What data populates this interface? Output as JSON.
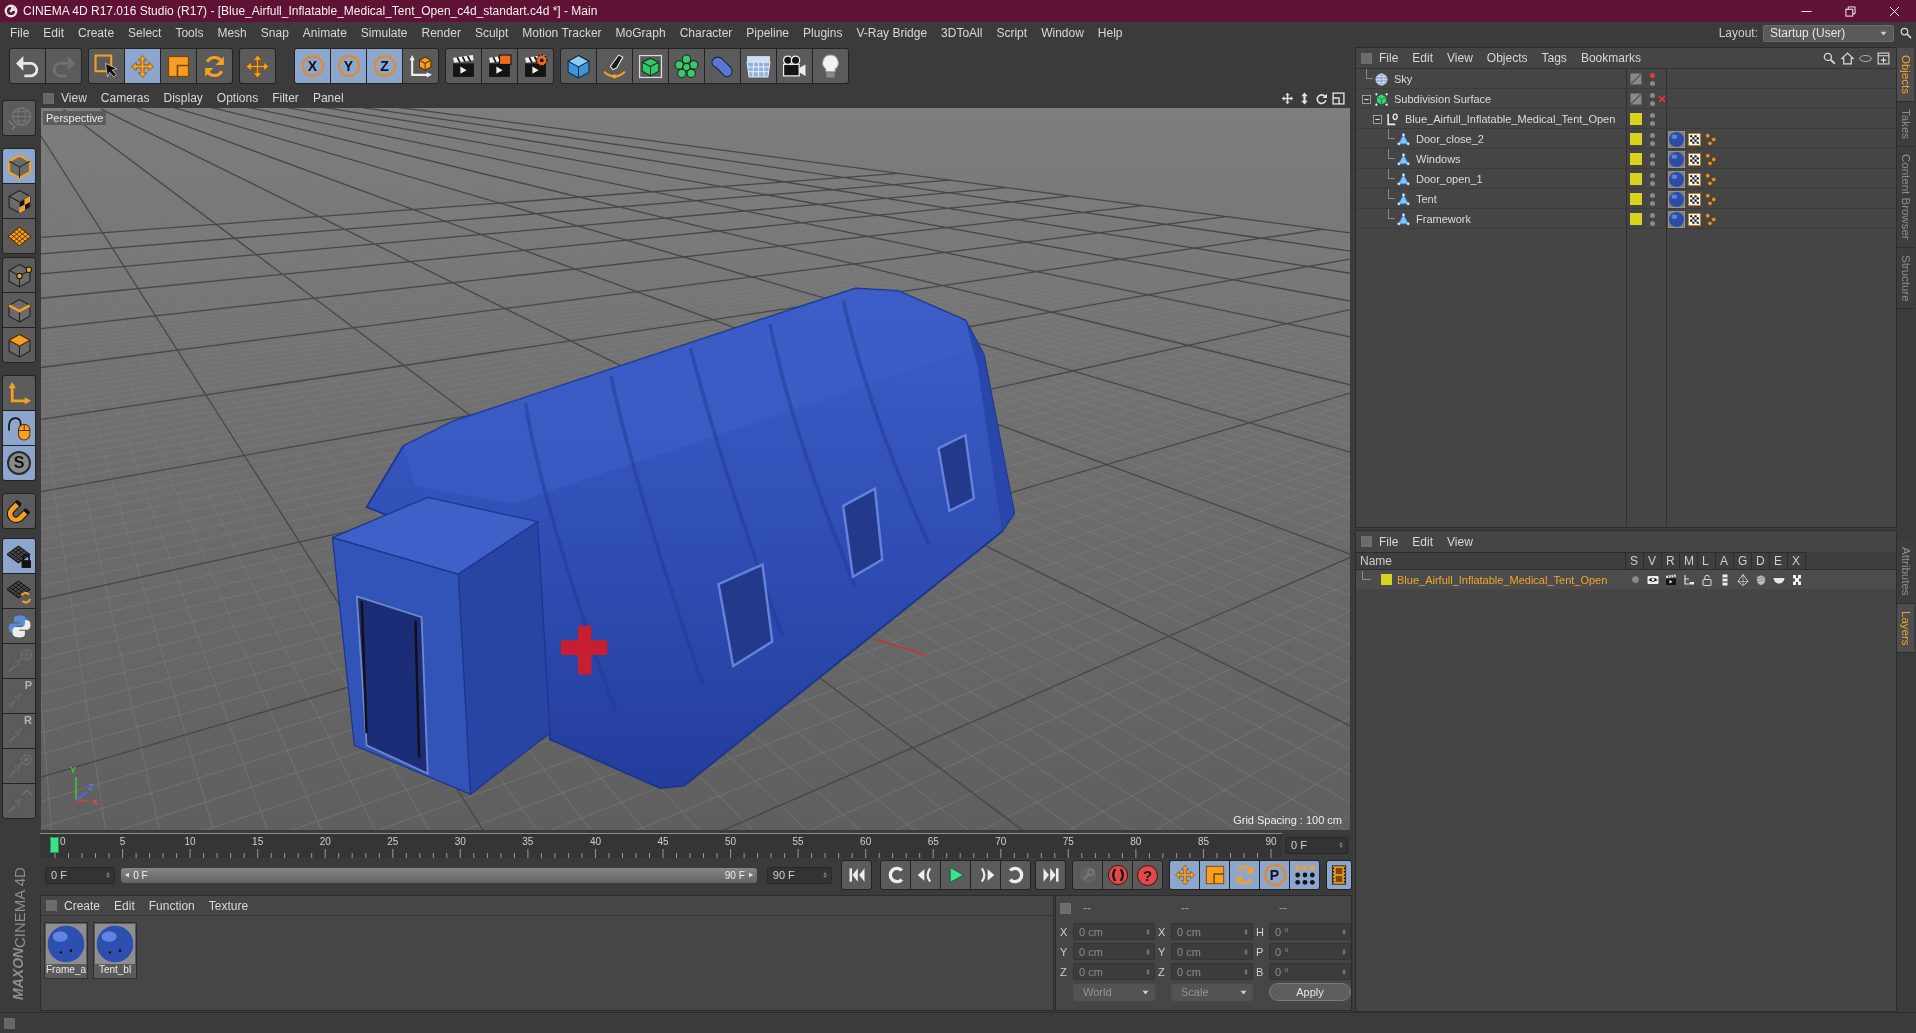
{
  "window": {
    "title": "CINEMA 4D R17.016 Studio (R17) - [Blue_Airfull_Inflatable_Medical_Tent_Open_c4d_standart.c4d *] - Main"
  },
  "menu_bar": [
    "File",
    "Edit",
    "Create",
    "Select",
    "Tools",
    "Mesh",
    "Snap",
    "Animate",
    "Simulate",
    "Render",
    "Sculpt",
    "Motion Tracker",
    "MoGraph",
    "Character",
    "Pipeline",
    "Plugins",
    "V-Ray Bridge",
    "3DToAll",
    "Script",
    "Window",
    "Help"
  ],
  "layout": {
    "label": "Layout:",
    "value": "Startup (User)"
  },
  "toolbar": [
    [
      {
        "kind": "undo",
        "on": false,
        "disabled": false
      },
      {
        "kind": "redo",
        "on": false,
        "disabled": true
      }
    ],
    [
      {
        "kind": "live_select",
        "on": false,
        "disabled": false
      },
      {
        "kind": "move",
        "on": true,
        "disabled": false
      },
      {
        "kind": "scale",
        "on": false,
        "disabled": false
      },
      {
        "kind": "rotate",
        "on": false,
        "disabled": false
      }
    ],
    [
      {
        "kind": "last_tool",
        "on": false,
        "disabled": false
      }
    ],
    [
      {
        "kind": "axis_lock",
        "label": "X",
        "on": true,
        "disabled": false
      },
      {
        "kind": "axis_lock",
        "label": "Y",
        "on": true,
        "disabled": false
      },
      {
        "kind": "axis_lock",
        "label": "Z",
        "on": true,
        "disabled": false
      },
      {
        "kind": "coord_system",
        "on": false,
        "disabled": false
      }
    ],
    [
      {
        "kind": "render_view",
        "on": false,
        "disabled": false
      },
      {
        "kind": "render_picture",
        "on": false,
        "disabled": false
      },
      {
        "kind": "render_settings",
        "on": false,
        "disabled": false
      }
    ],
    [
      {
        "kind": "cube",
        "on": false,
        "disabled": false
      },
      {
        "kind": "pen",
        "on": false,
        "disabled": false
      },
      {
        "kind": "subdivision",
        "on": false,
        "disabled": false
      },
      {
        "kind": "cloner",
        "on": false,
        "disabled": false
      },
      {
        "kind": "deformer",
        "on": false,
        "disabled": false
      },
      {
        "kind": "floor",
        "on": false,
        "disabled": false
      },
      {
        "kind": "camera",
        "on": false,
        "disabled": false
      },
      {
        "kind": "light",
        "on": false,
        "disabled": false
      }
    ]
  ],
  "left_toolbar": [
    [
      {
        "kind": "make_editable",
        "on": false,
        "disabled": true
      }
    ],
    [
      {
        "kind": "model",
        "on": true,
        "disabled": false
      },
      {
        "kind": "texture",
        "on": false,
        "disabled": false
      },
      {
        "kind": "workplane",
        "on": false,
        "disabled": false
      }
    ],
    [
      {
        "kind": "points",
        "on": false,
        "disabled": false
      },
      {
        "kind": "edges",
        "on": false,
        "disabled": false
      },
      {
        "kind": "polygons",
        "on": false,
        "disabled": false
      }
    ],
    [
      {
        "kind": "axis",
        "on": false,
        "disabled": false
      },
      {
        "kind": "tweak",
        "on": true,
        "disabled": false
      },
      {
        "kind": "snap",
        "label": "S",
        "on": true,
        "disabled": false
      }
    ],
    [
      {
        "kind": "magnet",
        "on": false,
        "disabled": false
      }
    ],
    [
      {
        "kind": "grid_lock",
        "on": true,
        "disabled": false
      },
      {
        "kind": "grid_rotate",
        "on": false,
        "disabled": false
      },
      {
        "kind": "script",
        "on": false,
        "disabled": false
      },
      {
        "kind": "pin_globe",
        "on": false,
        "disabled": true
      },
      {
        "kind": "pin_letter",
        "label": "P",
        "on": false,
        "disabled": true
      },
      {
        "kind": "pin_letter",
        "label": "R",
        "on": false,
        "disabled": true
      },
      {
        "kind": "pin_target",
        "on": false,
        "disabled": true
      },
      {
        "kind": "pin_arrow",
        "on": false,
        "disabled": true
      }
    ]
  ],
  "viewport": {
    "menu": [
      "View",
      "Cameras",
      "Display",
      "Options",
      "Filter",
      "Panel"
    ],
    "camera": "Perspective",
    "grid_spacing": "Grid Spacing : 100 cm",
    "axis_labels": [
      "Y",
      "Z",
      "X"
    ]
  },
  "timeline": {
    "ticks": [
      "0",
      "5",
      "10",
      "15",
      "20",
      "25",
      "30",
      "35",
      "40",
      "45",
      "50",
      "55",
      "60",
      "65",
      "70",
      "75",
      "80",
      "85",
      "90"
    ],
    "level": 0,
    "current_frame": "0 F"
  },
  "playback": {
    "start_field": "0 F",
    "range": {
      "start": "0 F",
      "end": "90 F",
      "level": 1
    },
    "end_field": "90 F",
    "transport": [
      [
        {
          "kind": "go_start"
        }
      ],
      [
        {
          "kind": "prev_key"
        },
        {
          "kind": "prev_frame"
        },
        {
          "kind": "play"
        },
        {
          "kind": "next_frame"
        },
        {
          "kind": "next_key"
        }
      ],
      [
        {
          "kind": "go_end"
        }
      ]
    ],
    "keys": [
      {
        "kind": "record",
        "disabled": true
      },
      {
        "kind": "autokey",
        "disabled": false
      },
      {
        "kind": "key_select",
        "label": "?",
        "disabled": false
      }
    ],
    "key_tracks": [
      {
        "kind": "move",
        "on": true
      },
      {
        "kind": "scale",
        "on": true
      },
      {
        "kind": "rotate",
        "on": true
      },
      {
        "kind": "param",
        "label": "P",
        "on": true
      },
      {
        "kind": "points",
        "on": true
      }
    ],
    "timeline_button": {
      "on": true
    }
  },
  "material_manager": {
    "menu": [
      "Create",
      "Edit",
      "Function",
      "Texture"
    ],
    "materials": [
      {
        "name": "Frame_a"
      },
      {
        "name": "Tent_bl"
      }
    ]
  },
  "coordinates": {
    "disabled": true,
    "headers": [
      "--",
      "--",
      "--"
    ],
    "rows": [
      [
        {
          "label": "X",
          "value": "0 cm"
        },
        {
          "label": "X",
          "value": "0 cm"
        },
        {
          "label": "H",
          "value": "0 °"
        }
      ],
      [
        {
          "label": "Y",
          "value": "0 cm"
        },
        {
          "label": "Y",
          "value": "0 cm"
        },
        {
          "label": "P",
          "value": "0 °"
        }
      ],
      [
        {
          "label": "Z",
          "value": "0 cm"
        },
        {
          "label": "Z",
          "value": "0 cm"
        },
        {
          "label": "B",
          "value": "0 °"
        }
      ]
    ],
    "dropdowns": [
      "World",
      "Scale"
    ],
    "apply": "Apply"
  },
  "object_manager": {
    "menu": [
      "File",
      "Edit",
      "View",
      "Objects",
      "Tags",
      "Bookmarks"
    ],
    "objects": [
      {
        "name": "Sky",
        "kind": "sky",
        "selected": false,
        "hidden_in_editor": true,
        "hidden_in_render": false
      },
      {
        "name": "Subdivision Surface",
        "kind": "subdivision",
        "selected": false,
        "hidden_in_editor": false,
        "hidden_in_render": false,
        "enabled": false,
        "expanded": true,
        "children": [
          {
            "name": "Blue_Airfull_Inflatable_Medical_Tent_Open",
            "kind": "null",
            "selected": false,
            "color": "#d9d21f",
            "hidden_in_editor": false,
            "hidden_in_render": false,
            "expanded": true,
            "children": [
              {
                "name": "Door_close_2",
                "kind": "polygon",
                "selected": false,
                "color": "#d9d21f",
                "hidden_in_editor": false,
                "hidden_in_render": false,
                "tags": [
                  {
                    "kind": "material"
                  },
                  {
                    "kind": "uvw"
                  },
                  {
                    "kind": "phong"
                  }
                ]
              },
              {
                "name": "Windows",
                "kind": "polygon",
                "selected": false,
                "color": "#d9d21f",
                "hidden_in_editor": false,
                "hidden_in_render": false,
                "tags": [
                  {
                    "kind": "material"
                  },
                  {
                    "kind": "uvw"
                  },
                  {
                    "kind": "phong"
                  }
                ]
              },
              {
                "name": "Door_open_1",
                "kind": "polygon",
                "selected": false,
                "color": "#d9d21f",
                "hidden_in_editor": false,
                "hidden_in_render": false,
                "tags": [
                  {
                    "kind": "material"
                  },
                  {
                    "kind": "uvw"
                  },
                  {
                    "kind": "phong"
                  }
                ]
              },
              {
                "name": "Tent",
                "kind": "polygon",
                "selected": false,
                "color": "#d9d21f",
                "hidden_in_editor": false,
                "hidden_in_render": false,
                "tags": [
                  {
                    "kind": "material"
                  },
                  {
                    "kind": "uvw"
                  },
                  {
                    "kind": "phong"
                  }
                ]
              },
              {
                "name": "Framework",
                "kind": "polygon",
                "selected": false,
                "color": "#d9d21f",
                "hidden_in_editor": false,
                "hidden_in_render": false,
                "tags": [
                  {
                    "kind": "material"
                  },
                  {
                    "kind": "uvw"
                  },
                  {
                    "kind": "phong"
                  }
                ]
              }
            ]
          }
        ]
      }
    ]
  },
  "layer_manager": {
    "menu": [
      "File",
      "Edit",
      "View"
    ],
    "columns": [
      "Name",
      "S",
      "V",
      "R",
      "M",
      "L",
      "A",
      "G",
      "D",
      "E",
      "X"
    ],
    "layers": [
      {
        "name": "Blue_Airfull_Inflatable_Medical_Tent_Open",
        "color": "#d9d21f",
        "selected": true
      }
    ]
  },
  "side_tabs": {
    "top": [
      {
        "label": "Objects",
        "selected": true
      },
      {
        "label": "Takes",
        "selected": false
      },
      {
        "label": "Content Browser",
        "selected": false
      },
      {
        "label": "Structure",
        "selected": false
      }
    ],
    "bottom": [
      {
        "label": "Attributes",
        "selected": false
      },
      {
        "label": "Layers",
        "selected": true
      }
    ]
  },
  "logo": {
    "brand": "MAXON",
    "product": "CINEMA 4D"
  }
}
